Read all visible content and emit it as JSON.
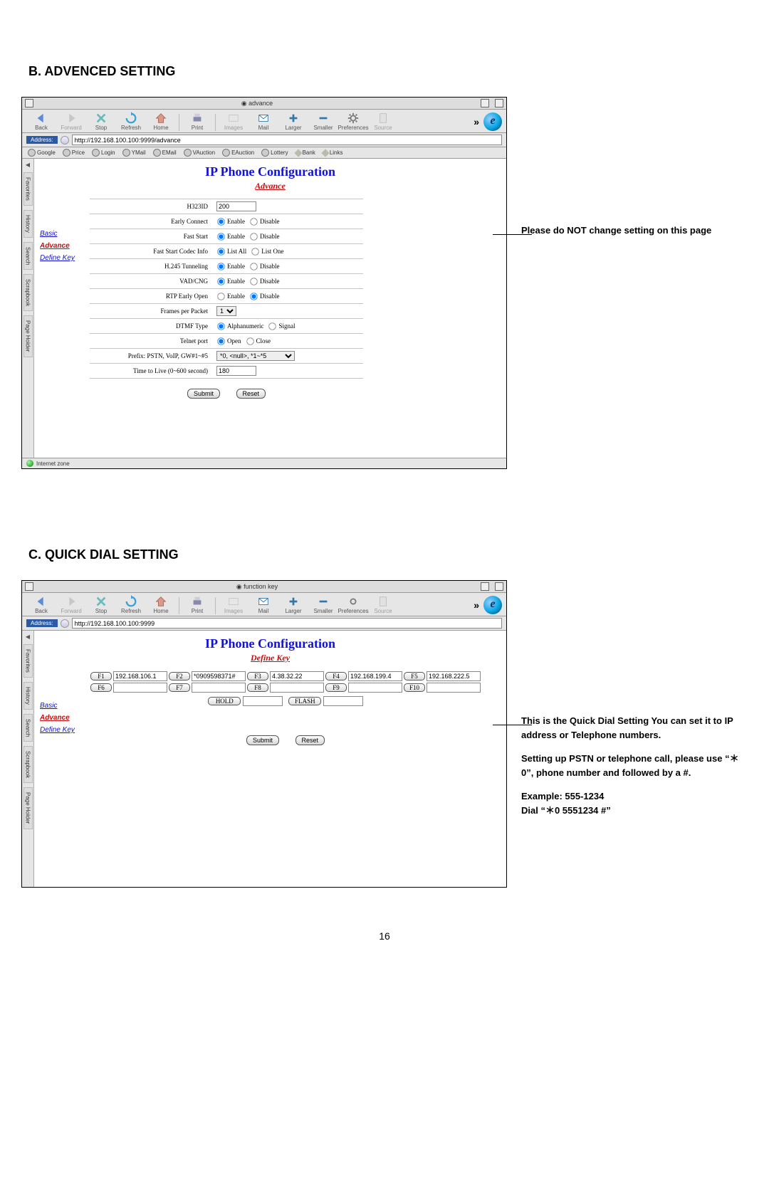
{
  "sections": {
    "b": "B. ADVENCED SETTING",
    "c": "C. QUICK DIAL SETTING"
  },
  "page_number": "16",
  "annotation_b": "Please do NOT change setting on this page",
  "annotation_c": {
    "p1": "This is the Quick Dial Setting You can set it to IP address or Telephone numbers.",
    "p2": "Setting up PSTN or telephone call, please use “＊0”, phone number and followed by a #.",
    "p3": "Example: 555-1234",
    "p4": "Dial “＊0 5551234 #”"
  },
  "browser": {
    "address_label": "Address:",
    "toolbar": [
      "Back",
      "Forward",
      "Stop",
      "Refresh",
      "Home",
      "Print",
      "Images",
      "Mail",
      "Larger",
      "Smaller",
      "Preferences",
      "Source"
    ],
    "more": "»",
    "favorites": [
      "Google",
      "Price",
      "Login",
      "YMail",
      "EMail",
      "VAuction",
      "EAuction",
      "Lottery",
      "Bank",
      "Links"
    ],
    "side_tabs": [
      "Favorites",
      "History",
      "Search",
      "Scrapbook",
      "Page Holder"
    ],
    "status": "Internet zone"
  },
  "win_b": {
    "tab_title": "advance",
    "url": "http://192.168.100.100:9999/advance",
    "page_title": "IP Phone Configuration",
    "page_sub": "Advance",
    "nav": {
      "basic": "Basic",
      "advance": "Advance",
      "definekey": "Define Key"
    },
    "rows": {
      "h323id": {
        "label": "H323ID",
        "value": "200"
      },
      "early": {
        "label": "Early Connect",
        "a": "Enable",
        "b": "Disable"
      },
      "fast": {
        "label": "Fast Start",
        "a": "Enable",
        "b": "Disable"
      },
      "codec": {
        "label": "Fast Start Codec Info",
        "a": "List All",
        "b": "List One"
      },
      "h245": {
        "label": "H.245 Tunneling",
        "a": "Enable",
        "b": "Disable"
      },
      "vad": {
        "label": "VAD/CNG",
        "a": "Enable",
        "b": "Disable"
      },
      "rtp": {
        "label": "RTP Early Open",
        "a": "Enable",
        "b": "Disable"
      },
      "fpp": {
        "label": "Frames per Packet",
        "value": "1"
      },
      "dtmf": {
        "label": "DTMF Type",
        "a": "Alphanumeric",
        "b": "Signal"
      },
      "telnet": {
        "label": "Telnet port",
        "a": "Open",
        "b": "Close"
      },
      "prefix": {
        "label": "Prefix: PSTN, VoIP, GW#1~#5",
        "value": "*0, <null>, *1~*5"
      },
      "ttl": {
        "label": "Time to Live (0~600 second)",
        "value": "180"
      }
    },
    "submit": "Submit",
    "reset": "Reset"
  },
  "win_c": {
    "tab_title": "function key",
    "url": "http://192.168.100.100:9999",
    "page_title": "IP Phone Configuration",
    "page_sub": "Define Key",
    "nav": {
      "basic": "Basic",
      "advance": "Advance",
      "definekey": "Define Key"
    },
    "keys": {
      "f1": {
        "label": "F1",
        "value": "192.168.106.1"
      },
      "f2": {
        "label": "F2",
        "value": "*0909598371#"
      },
      "f3": {
        "label": "F3",
        "value": "4.38.32.22"
      },
      "f4": {
        "label": "F4",
        "value": "192.168.199.4"
      },
      "f5": {
        "label": "F5",
        "value": "192.168.222.5"
      },
      "f6": {
        "label": "F6",
        "value": ""
      },
      "f7": {
        "label": "F7",
        "value": ""
      },
      "f8": {
        "label": "F8",
        "value": ""
      },
      "f9": {
        "label": "F9",
        "value": ""
      },
      "f10": {
        "label": "F10",
        "value": ""
      },
      "hold": {
        "label": "HOLD",
        "value": ""
      },
      "flash": {
        "label": "FLASH",
        "value": ""
      }
    },
    "submit": "Submit",
    "reset": "Reset"
  }
}
